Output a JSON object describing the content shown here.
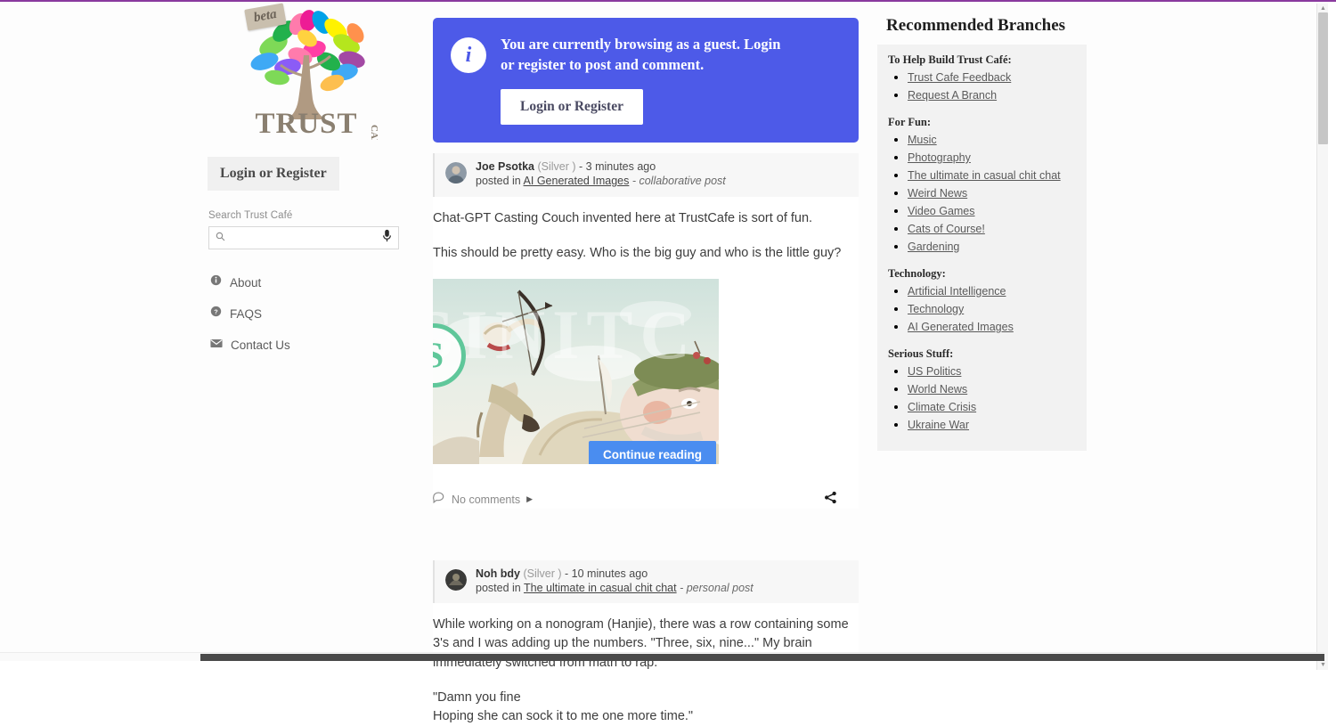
{
  "site": {
    "brand_name": "TRUST",
    "brand_suffix": "CAFÉ",
    "beta_badge": "beta",
    "accent_purple": "#8a3a9e",
    "banner_blue": "#4d5ae8",
    "button_blue": "#4a8df0"
  },
  "sidebar": {
    "login_button": "Login or Register",
    "search_label": "Search Trust Café",
    "search_value": "",
    "search_placeholder": "",
    "links": [
      {
        "label": "About",
        "icon": "info-icon"
      },
      {
        "label": "FAQS",
        "icon": "question-icon"
      },
      {
        "label": "Contact Us",
        "icon": "envelope-icon"
      }
    ]
  },
  "guest_banner": {
    "icon": "info-icon",
    "message": "You are currently browsing as a guest. Login or register to post and comment.",
    "button_label": "Login or Register"
  },
  "posts": [
    {
      "author": "Joe Psotka",
      "rank": "(Silver )",
      "time": "- 3 minutes ago",
      "posted_in_prefix": "posted in",
      "branch": "AI Generated Images",
      "post_type": "- collaborative post",
      "paragraphs": [
        "Chat-GPT Casting Couch invented here at TrustCafe is sort of fun.",
        "This should be pretty easy.  Who is the big guy and who is the little guy?"
      ],
      "has_image": true,
      "image_watermark_text": "SINITC",
      "continue_label": "Continue reading",
      "comments_label": "No comments",
      "share_icon": "share-icon"
    },
    {
      "author": "Noh bdy",
      "rank": "(Silver )",
      "time": "- 10 minutes ago",
      "posted_in_prefix": "posted in",
      "branch": "The ultimate in casual chit chat",
      "post_type": "- personal post",
      "paragraphs": [
        "While working on a nonogram (Hanjie), there was a row containing some 3's and I was adding up the numbers. \"Three, six, nine...\" My brain immediately switched from math to rap.",
        "\"Damn you fine\nHoping she can sock it to me one more time.\""
      ],
      "has_image": false
    }
  ],
  "recommended": {
    "title": "Recommended Branches",
    "groups": [
      {
        "title": "To Help Build Trust Café:",
        "items": [
          "Trust Cafe Feedback",
          "Request A Branch"
        ]
      },
      {
        "title": "For Fun:",
        "items": [
          "Music",
          "Photography",
          "The ultimate in casual chit chat",
          "Weird News",
          "Video Games",
          "Cats of Course!",
          "Gardening"
        ]
      },
      {
        "title": "Technology:",
        "items": [
          "Artificial Intelligence",
          "Technology",
          "AI Generated Images"
        ]
      },
      {
        "title": "Serious Stuff:",
        "items": [
          "US Politics",
          "World News",
          "Climate Crisis",
          "Ukraine War"
        ]
      }
    ]
  }
}
